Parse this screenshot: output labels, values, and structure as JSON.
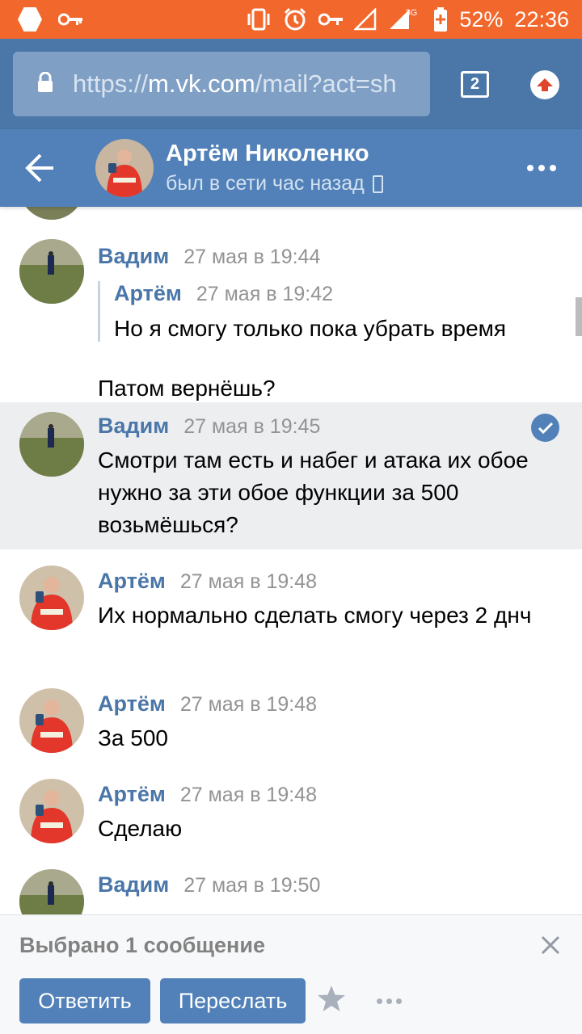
{
  "status_bar": {
    "battery": "52%",
    "time": "22:36",
    "network": "3G"
  },
  "browser": {
    "url_prefix": "https://",
    "url_domain": "m.vk.com",
    "url_path": "/mail?act=sh",
    "tab_count": "2"
  },
  "chat_header": {
    "name": "Артём Николенко",
    "status": "был в сети час назад"
  },
  "messages": [
    {
      "author": "Вадим",
      "time": "27 мая в 19:44",
      "quote": {
        "author": "Артём",
        "time": "27 мая в 19:42",
        "text": "Но я смогу только пока убрать время"
      },
      "text": "Патом вернёшь?"
    },
    {
      "author": "Вадим",
      "time": "27 мая в 19:45",
      "text": "Смотри там есть и набег и атака их обое нужно за эти обое функции за 500 возьмёшься?",
      "selected": true
    },
    {
      "author": "Артём",
      "time": "27 мая в 19:48",
      "text": "Их нормально сделать смогу через 2 днч"
    },
    {
      "author": "Артём",
      "time": "27 мая в 19:48",
      "text": "За 500"
    },
    {
      "author": "Артём",
      "time": "27 мая в 19:48",
      "text": "Сделаю"
    },
    {
      "author": "Вадим",
      "time": "27 мая в 19:50",
      "text": ""
    }
  ],
  "footer": {
    "selected_label": "Выбрано 1 сообщение",
    "reply_label": "Ответить",
    "forward_label": "Переслать"
  },
  "icons": {
    "back": "arrow-left-icon",
    "more": "dots-icon",
    "check": "check-circle-icon",
    "close": "close-icon",
    "star": "star-icon",
    "lock": "lock-icon"
  },
  "colors": {
    "status_bar": "#f2672b",
    "browser_bar": "#4a76a8",
    "vk_header": "#5181b8",
    "link_blue": "#4a76a8",
    "selected_bg": "#edeef0"
  }
}
